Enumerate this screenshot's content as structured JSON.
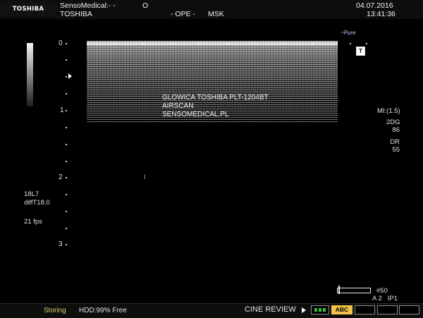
{
  "header": {
    "brand": "TOSHIBA",
    "institution": "SensoMedical:- -",
    "institution_mark": "O",
    "device": "TOSHIBA",
    "operator": "- OPE -",
    "preset": "MSK",
    "date": "04.07.2016",
    "time": "13:41:36"
  },
  "logo": {
    "pure": "Pure",
    "t_badge": "T"
  },
  "depth_scale": {
    "labels": [
      "0",
      "1",
      "2",
      "3"
    ]
  },
  "overlay_text": [
    "GLOWICA TOSHIBA PLT-1204BT",
    "AIRSCAN",
    "SENSOMEDICAL.PL"
  ],
  "right_params": {
    "mi": "MI:(1.5)",
    "mode": "2DG",
    "gain": "86",
    "dr_label": "DR",
    "dr_value": "55"
  },
  "left_params": {
    "probe": "18L7",
    "preset": "diffT18.0",
    "fps": "21 fps"
  },
  "cine": {
    "frame": "#50",
    "position_fraction": 0.02,
    "info": "A 2   IP1"
  },
  "cursor_mark": "I",
  "footer": {
    "status": "Storing",
    "hdd": "HDD:99% Free",
    "cine_review": "CINE REVIEW",
    "abc_label": "ABC"
  },
  "colors": {
    "status_text": "#d7cf6a",
    "abc_button": "#f3c24a",
    "green_indicator": "#37c13a",
    "cursor": "#d9a25a"
  }
}
